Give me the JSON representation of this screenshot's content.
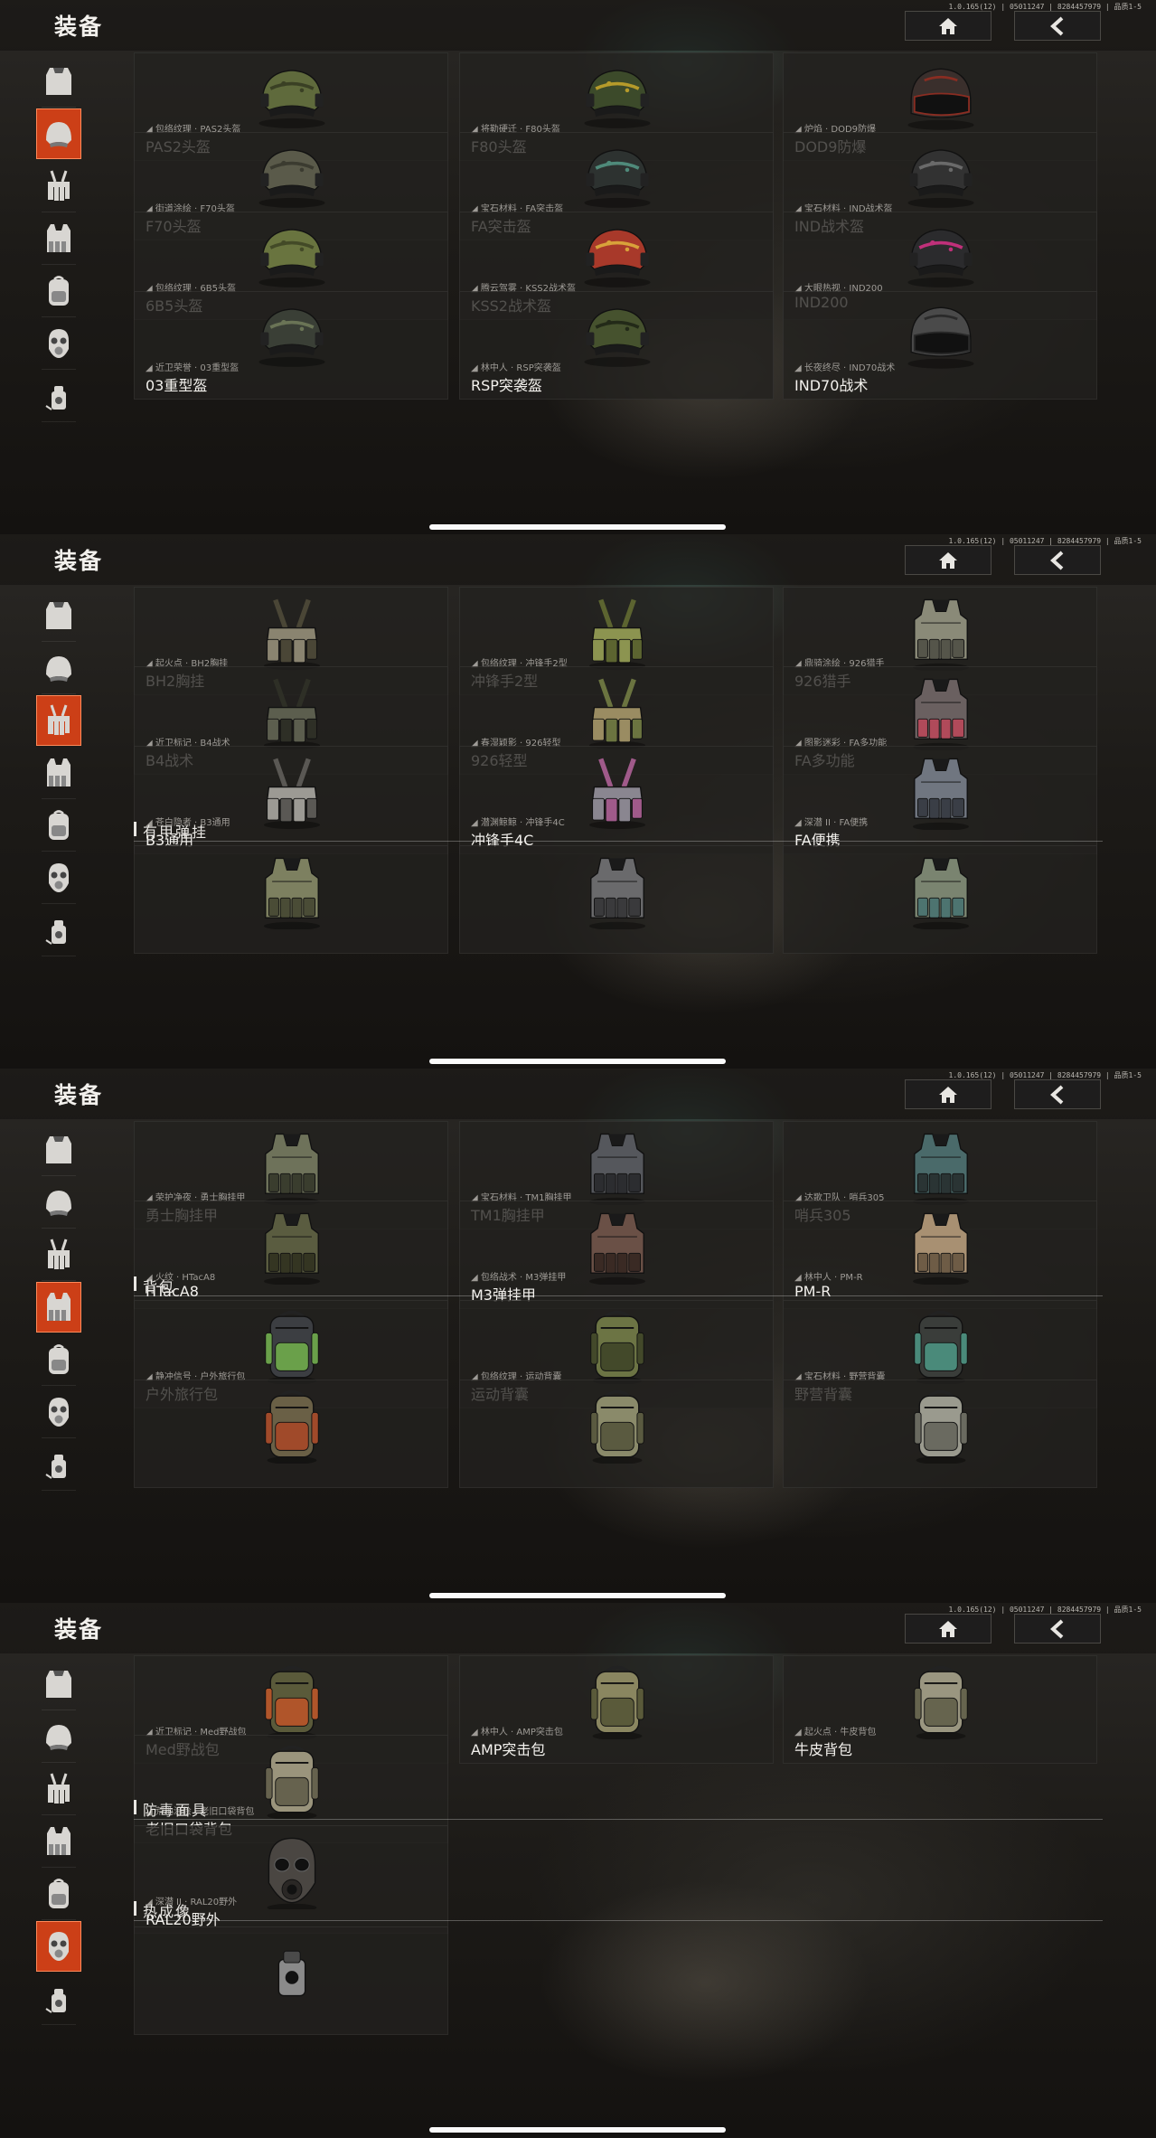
{
  "app": {
    "title": "装备",
    "version": "1.0.165(12) | 05011247 | 8284457979 | 品质1-5",
    "home_icon": "home-icon",
    "back_icon": "chevron-left-icon"
  },
  "sidebar": [
    {
      "name": "vest",
      "icon": "vest-icon"
    },
    {
      "name": "helmet",
      "icon": "helmet-icon"
    },
    {
      "name": "chest-rig",
      "icon": "chest-rig-icon"
    },
    {
      "name": "armored-rig",
      "icon": "armored-rig-icon"
    },
    {
      "name": "backpack",
      "icon": "backpack-icon"
    },
    {
      "name": "gas-mask",
      "icon": "gas-mask-icon"
    },
    {
      "name": "thermal",
      "icon": "thermal-icon"
    }
  ],
  "colors": {
    "active": "#cc3f17",
    "card": "#22211f",
    "text": "#f3f1ed",
    "subtext": "#9e9b96"
  },
  "panels": [
    {
      "active_index": 1,
      "items": [
        {
          "skin": "◢ 包络纹理 · PAS2头盔",
          "name": "PAS2头盔",
          "kind": "helmet",
          "color": "#5f6a3c",
          "accent": "#3a4024"
        },
        {
          "skin": "◢ 将勒硬迁 · F80头盔",
          "name": "F80头盔",
          "kind": "helmet",
          "color": "#3c4a2a",
          "accent": "#b59a2a"
        },
        {
          "skin": "◢ 炉焰 · DOD9防爆",
          "name": "DOD9防爆",
          "kind": "visor",
          "color": "#3a2f2c",
          "accent": "#8a2d22"
        },
        {
          "skin": "◢ 街道涂绘 · F70头盔",
          "name": "F70头盔",
          "kind": "helmet",
          "color": "#5a5a4a",
          "accent": "#3b3b30"
        },
        {
          "skin": "◢ 宝石材料 · FA突击盔",
          "name": "FA突击盔",
          "kind": "helmet",
          "color": "#2d3230",
          "accent": "#4f8a7a"
        },
        {
          "skin": "◢ 宝石材料 · IND战术盔",
          "name": "IND战术盔",
          "kind": "helmet",
          "color": "#323232",
          "accent": "#6a6a6a"
        },
        {
          "skin": "◢ 包络纹理 · 6B5头盔",
          "name": "6B5头盔",
          "kind": "helmet",
          "color": "#69743f",
          "accent": "#434a27"
        },
        {
          "skin": "◢ 腾云驾雾 · KSS2战术盔",
          "name": "KSS2战术盔",
          "kind": "helmet",
          "color": "#a8392a",
          "accent": "#d8a23a"
        },
        {
          "skin": "◢ 大眼热视 · IND200",
          "name": "IND200",
          "kind": "helmet",
          "color": "#2b2b2d",
          "accent": "#c0307a"
        },
        {
          "skin": "◢ 近卫荣誉 · 03重型盔",
          "name": "03重型盔",
          "kind": "helmet",
          "color": "#3a3f36",
          "accent": "#6a7456"
        },
        {
          "skin": "◢ 林中人 · RSP突袭盔",
          "name": "RSP突袭盔",
          "kind": "helmet",
          "color": "#46522e",
          "accent": "#232a18"
        },
        {
          "skin": "◢ 长夜终尽 · IND70战术",
          "name": "IND70战术",
          "kind": "visor",
          "color": "#4a4a4a",
          "accent": "#2a2a2a"
        }
      ]
    },
    {
      "active_index": 2,
      "items": [
        {
          "skin": "◢ 起火点 · BH2胸挂",
          "name": "BH2胸挂",
          "kind": "rig",
          "color": "#8a8470",
          "accent": "#4a4636"
        },
        {
          "skin": "◢ 包络纹理 · 冲锋手2型",
          "name": "冲锋手2型",
          "kind": "rig",
          "color": "#8c9450",
          "accent": "#5c6430"
        },
        {
          "skin": "◢ 鼎骑涂绘 · 926猎手",
          "name": "926猎手",
          "kind": "plate",
          "color": "#8a8a78",
          "accent": "#55554a"
        },
        {
          "skin": "◢ 近卫标记 · B4战术",
          "name": "B4战术",
          "kind": "rig",
          "color": "#5c5e4e",
          "accent": "#2e2f26"
        },
        {
          "skin": "◢ 春湿颖影 · 926轻型",
          "name": "926轻型",
          "kind": "rig",
          "color": "#9a8c62",
          "accent": "#6b7440"
        },
        {
          "skin": "◢ 图影迷彩 · FA多功能",
          "name": "FA多功能",
          "kind": "plate",
          "color": "#6a6060",
          "accent": "#b04a5a"
        },
        {
          "skin": "◢ 苍白隐者 · B3通用",
          "name": "B3通用",
          "kind": "rig",
          "color": "#9c9a94",
          "accent": "#5a5854"
        },
        {
          "skin": "◢ 潜渊鲸鲸 · 冲锋手4C",
          "name": "冲锋手4C",
          "kind": "rig",
          "color": "#8a8690",
          "accent": "#a05a8a"
        },
        {
          "skin": "◢ 深潜 II · FA便携",
          "name": "FA便携",
          "kind": "plate",
          "color": "#707680",
          "accent": "#3a3e46"
        }
      ],
      "section": "有甲弹挂",
      "tail": [
        {
          "kind": "plate",
          "color": "#7d8060",
          "accent": "#4a4c36"
        },
        {
          "kind": "plate",
          "color": "#6a6a6c",
          "accent": "#3a3a3c"
        },
        {
          "kind": "plate",
          "color": "#7a8470",
          "accent": "#4d7470"
        }
      ]
    },
    {
      "active_index": 3,
      "items": [
        {
          "skin": "◢ 荣护净夜 · 勇士胸挂甲",
          "name": "勇士胸挂甲",
          "kind": "plate",
          "color": "#6e725a",
          "accent": "#3a3d2e"
        },
        {
          "skin": "◢ 宝石材料 · TM1胸挂甲",
          "name": "TM1胸挂甲",
          "kind": "plate",
          "color": "#55575c",
          "accent": "#2c2d30"
        },
        {
          "skin": "◢ 达歌卫队 · 哨兵305",
          "name": "哨兵305",
          "kind": "plate",
          "color": "#4a6a6a",
          "accent": "#2a3434"
        },
        {
          "skin": "◢ 火纹 · HTacA8",
          "name": "HTacA8",
          "kind": "plate",
          "color": "#5a5c40",
          "accent": "#343522"
        },
        {
          "skin": "◢ 包络战术 · M3弹挂甲",
          "name": "M3弹挂甲",
          "kind": "plate",
          "color": "#6a5046",
          "accent": "#3a2a24"
        },
        {
          "skin": "◢ 林中人 · PM-R",
          "name": "PM-R",
          "kind": "plate",
          "color": "#a89072",
          "accent": "#6e5c46"
        }
      ],
      "section": "背包",
      "items2": [
        {
          "skin": "◢ 静冲信号 · 户外旅行包",
          "name": "户外旅行包",
          "kind": "pack",
          "color": "#3c3e42",
          "accent": "#6aa04a"
        },
        {
          "skin": "◢ 包络纹理 · 运动背囊",
          "name": "运动背囊",
          "kind": "pack",
          "color": "#6c7444",
          "accent": "#43492a"
        },
        {
          "skin": "◢ 宝石材料 · 野营背囊",
          "name": "野营背囊",
          "kind": "pack",
          "color": "#3a3d3a",
          "accent": "#4a8a7a"
        }
      ],
      "tail": [
        {
          "kind": "pack",
          "color": "#6a6046",
          "accent": "#a04a2a"
        },
        {
          "kind": "pack",
          "color": "#8a8a6a",
          "accent": "#5a5a40"
        },
        {
          "kind": "pack",
          "color": "#9a9a8e",
          "accent": "#6a6a60"
        }
      ]
    },
    {
      "active_index": 5,
      "items": [
        {
          "skin": "◢ 近卫标记 · Med野战包",
          "name": "Med野战包",
          "kind": "pack",
          "color": "#5a5a3a",
          "accent": "#b0552a"
        },
        {
          "skin": "◢ 林中人 · AMP突击包",
          "name": "AMP突击包",
          "kind": "pack",
          "color": "#8a8660",
          "accent": "#5a5a3a"
        },
        {
          "skin": "◢ 起火点 · 牛皮背包",
          "name": "牛皮背包",
          "kind": "pack",
          "color": "#9a9680",
          "accent": "#66644e"
        },
        {
          "skin": "◢ 荒地涂绘 · 老旧口袋背包",
          "name": "老旧口袋背包",
          "kind": "pack",
          "color": "#9a947c",
          "accent": "#66624e"
        }
      ],
      "section": "防毒面具",
      "items2": [
        {
          "skin": "◢ 深潜 II · RAL20野外",
          "name": "RAL20野外",
          "kind": "mask",
          "color": "#4a4642",
          "accent": "#2a2725"
        }
      ],
      "section2": "热成像",
      "tail": [
        {
          "kind": "thermal",
          "color": "#8a8a8a",
          "accent": "#4a4a4a"
        }
      ]
    }
  ]
}
